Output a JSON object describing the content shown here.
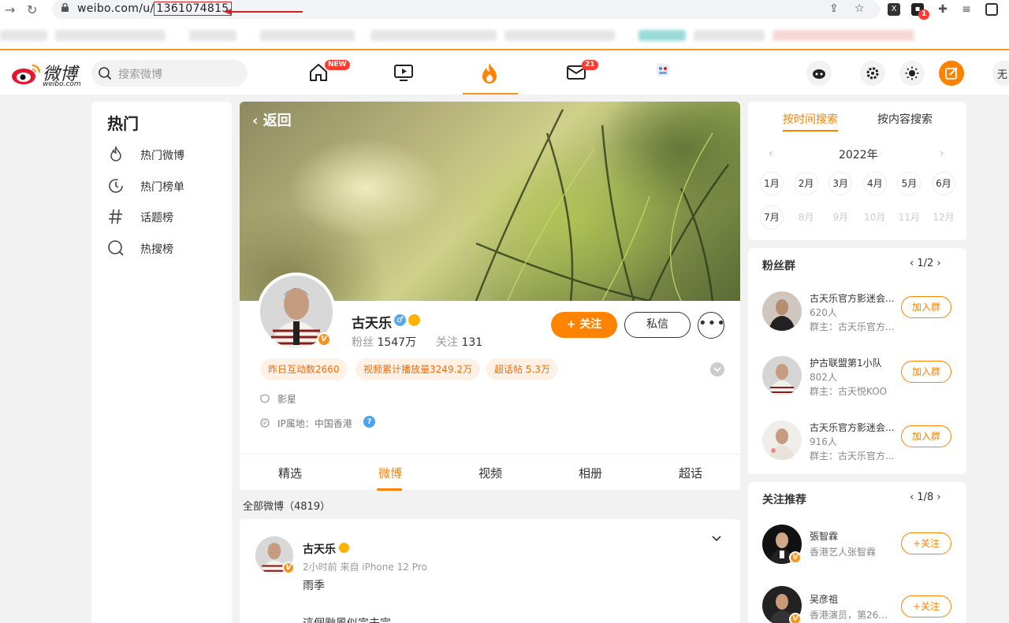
{
  "browser": {
    "url_prefix": "weibo.com/u/",
    "url_id": "1361074815"
  },
  "header": {
    "logo_text": "微博",
    "logo_sub": "weibo.com",
    "search_placeholder": "搜索微博",
    "home_badge": "NEW",
    "mail_badge": "21",
    "edge_text": "无"
  },
  "sidebar": {
    "title": "热门",
    "items": [
      {
        "label": "热门微博",
        "icon": "flame-icon"
      },
      {
        "label": "热门榜单",
        "icon": "clock-icon"
      },
      {
        "label": "话题榜",
        "icon": "hash-icon"
      },
      {
        "label": "热搜榜",
        "icon": "search-ring-icon"
      }
    ]
  },
  "profile": {
    "back_label": "返回",
    "name": "古天乐",
    "fans_label": "粉丝",
    "fans_value": "1547万",
    "following_label": "关注",
    "following_value": "131",
    "follow_button": "+ 关注",
    "message_button": "私信",
    "more_button": "•••",
    "tags": [
      "昨日互动数2660",
      "视频累计播放量3249.2万",
      "超话帖 5.3万"
    ],
    "category": "影星",
    "ip_location": "IP属地：中国香港"
  },
  "tabs": [
    "精选",
    "微博",
    "视频",
    "相册",
    "超话"
  ],
  "active_tab": "微博",
  "feed": {
    "count_label": "全部微博（4819）",
    "post": {
      "author": "古天乐",
      "meta": "2小时前  来自 iPhone 12 Pro",
      "text": "雨季",
      "text2": "這個颱風似完未完"
    }
  },
  "search_by": {
    "tab_time": "按时间搜索",
    "tab_content": "按内容搜索",
    "year": "2022年",
    "months": [
      "1月",
      "2月",
      "3月",
      "4月",
      "5月",
      "6月",
      "7月",
      "8月",
      "9月",
      "10月",
      "11月",
      "12月"
    ],
    "enabled_months": 7
  },
  "fan_groups": {
    "title": "粉丝群",
    "pager": "1/2",
    "join_label": "加入群",
    "items": [
      {
        "name": "古天乐官方影迷会...",
        "members": "620人",
        "owner": "群主：古天乐官方..."
      },
      {
        "name": "护古联盟第1小队",
        "members": "802人",
        "owner": "群主：古天悦KOO"
      },
      {
        "name": "古天乐官方影迷会...",
        "members": "916人",
        "owner": "群主：古天乐官方..."
      }
    ]
  },
  "recommend": {
    "title": "关注推荐",
    "pager": "1/8",
    "follow_label": "+关注",
    "items": [
      {
        "name": "張智霖",
        "desc": "香港艺人张智霖"
      },
      {
        "name": "吴彦祖",
        "desc": "香港演员，第26..."
      }
    ]
  },
  "colors": {
    "accent": "#ff8200",
    "brand": "#e6162d"
  }
}
